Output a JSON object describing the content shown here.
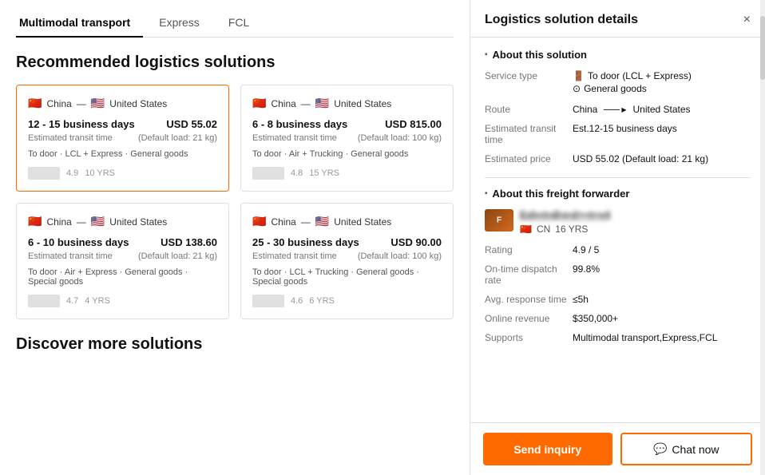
{
  "tabs": [
    {
      "label": "Multimodal transport",
      "active": true
    },
    {
      "label": "Express",
      "active": false
    },
    {
      "label": "FCL",
      "active": false
    }
  ],
  "section_title": "Recommended logistics solutions",
  "cards": [
    {
      "id": "card1",
      "active": true,
      "route_from": "China",
      "route_to": "United States",
      "transit_time": "12 - 15 business days",
      "transit_label": "Estimated transit time",
      "price": "USD 55.02",
      "price_note": "(Default load: 21 kg)",
      "tags": "To door · LCL + Express · General goods",
      "footer_years": "10 YRS",
      "footer_rating": "4.9"
    },
    {
      "id": "card2",
      "active": false,
      "route_from": "China",
      "route_to": "United States",
      "transit_time": "6 - 8 business days",
      "transit_label": "Estimated transit time",
      "price": "USD 815.00",
      "price_note": "(Default load: 100 kg)",
      "tags": "To door · Air + Trucking · General goods",
      "footer_years": "15 YRS",
      "footer_rating": "4.8"
    },
    {
      "id": "card3",
      "active": false,
      "route_from": "China",
      "route_to": "United States",
      "transit_time": "6 - 10 business days",
      "transit_label": "Estimated transit time",
      "price": "USD 138.60",
      "price_note": "(Default load: 21 kg)",
      "tags": "To door · Air + Express · General goods · Special goods",
      "footer_years": "4 YRS",
      "footer_rating": "4.7"
    },
    {
      "id": "card4",
      "active": false,
      "route_from": "China",
      "route_to": "United States",
      "transit_time": "25 - 30 business days",
      "transit_label": "Estimated transit time",
      "price": "USD 90.00",
      "price_note": "(Default load: 100 kg)",
      "tags": "To door · LCL + Trucking · General goods · Special goods",
      "footer_years": "6 YRS",
      "footer_rating": "4.6"
    }
  ],
  "discover_title": "Discover more solutions",
  "panel": {
    "title": "Logistics solution details",
    "close_label": "×",
    "about_solution_title": "About this solution",
    "fields": {
      "service_type_label": "Service type",
      "service_type_line1": "To door (LCL + Express)",
      "service_type_line2": "General goods",
      "route_label": "Route",
      "route_from": "China",
      "route_to": "United States",
      "transit_label": "Estimated transit time",
      "transit_value": "Est.12-15 business days",
      "price_label": "Estimated price",
      "price_value": "USD  55.02 (Default load: 21 kg)"
    },
    "about_forwarder_title": "About this freight forwarder",
    "forwarder": {
      "name_blurred": "Esh•rt•dl•e•d+••t••v4",
      "flag": "🇨🇳",
      "country": "CN",
      "years": "16 YRS",
      "rating_label": "Rating",
      "rating_value": "4.9 / 5",
      "dispatch_label": "On-time dispatch rate",
      "dispatch_value": "99.8%",
      "response_label": "Avg. response time",
      "response_value": "≤5h",
      "revenue_label": "Online revenue",
      "revenue_value": "$350,000+",
      "supports_label": "Supports",
      "supports_value": "Multimodal transport,Express,FCL"
    }
  },
  "buttons": {
    "inquiry": "Send inquiry",
    "chat": "Chat now"
  }
}
